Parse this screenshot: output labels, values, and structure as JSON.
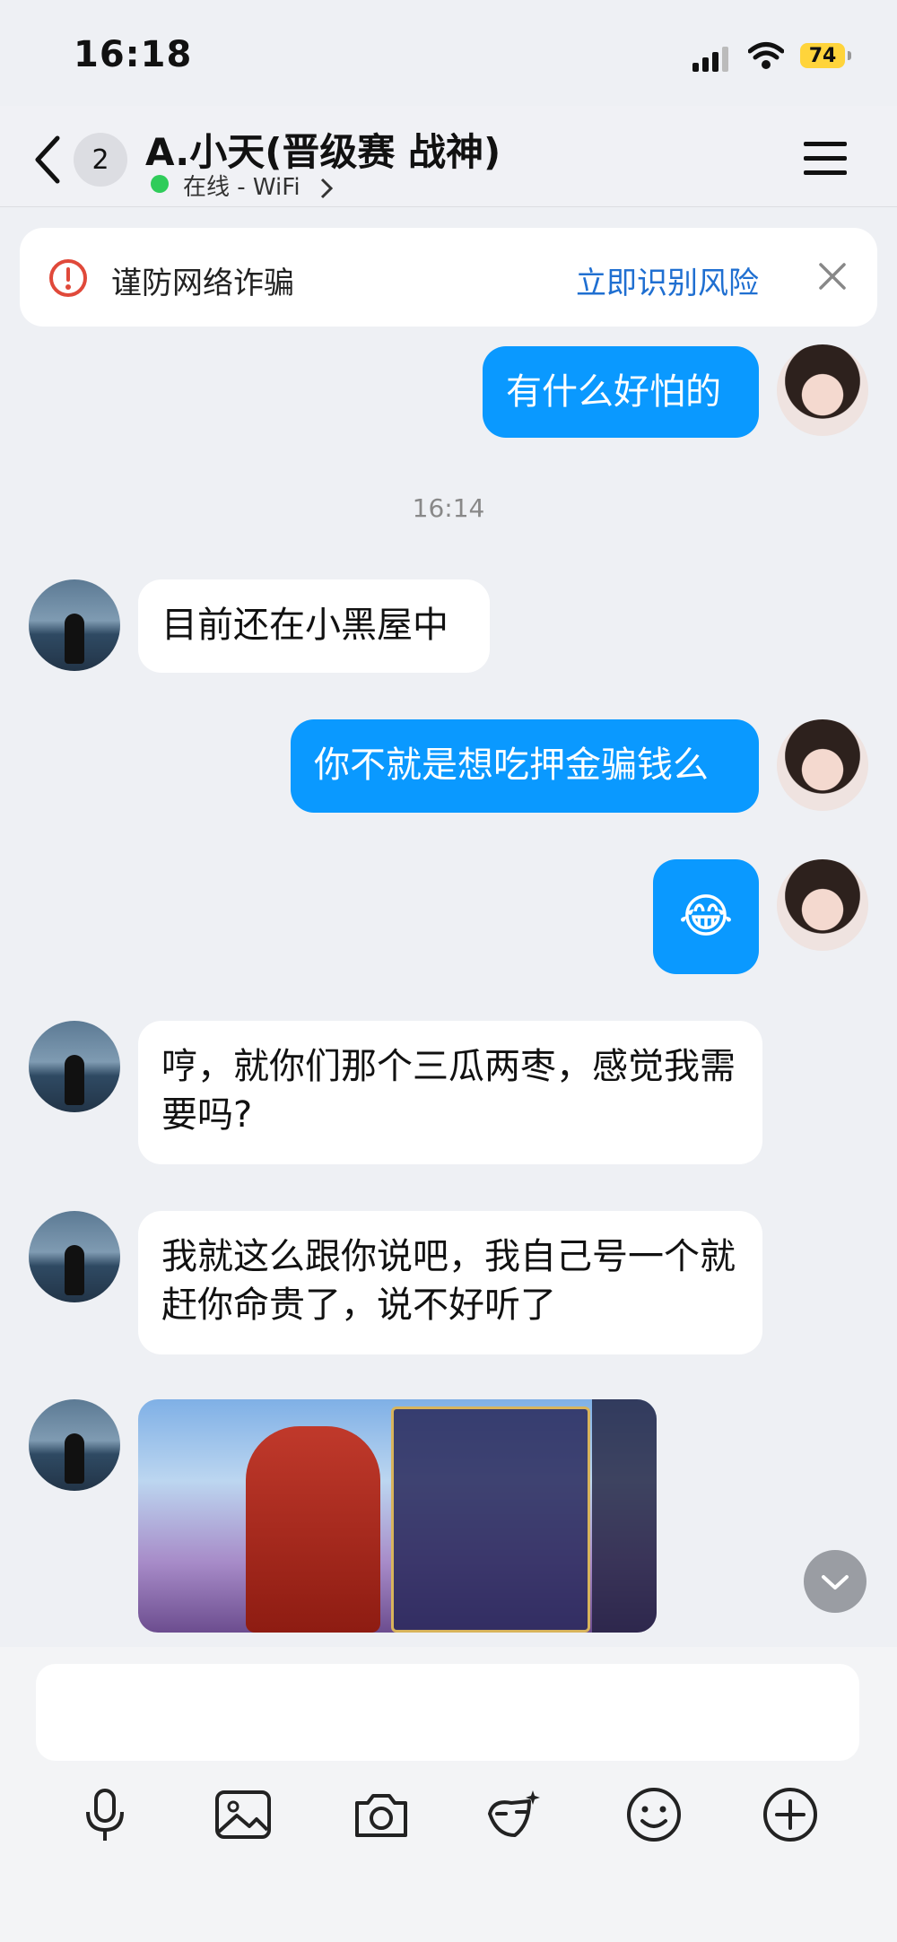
{
  "status_bar": {
    "time": "16:18",
    "battery": "74"
  },
  "header": {
    "unread_count": "2",
    "title": "A.小天(晋级赛 战神)",
    "status": "在线 - WiFi"
  },
  "warning": {
    "text": "谨防网络诈骗",
    "action": "立即识别风险"
  },
  "messages": [
    {
      "side": "out",
      "text": "有什么好怕的"
    },
    {
      "timestamp": "16:14"
    },
    {
      "side": "in",
      "text": "目前还在小黑屋中"
    },
    {
      "side": "out",
      "text": "你不就是想吃押金骗钱么"
    },
    {
      "side": "out",
      "text": "😂"
    },
    {
      "side": "in",
      "text": "哼，就你们那个三瓜两枣，感觉我需要吗?"
    },
    {
      "side": "in",
      "text": "我就这么跟你说吧，我自己号一个就赶你命贵了，说不好听了"
    },
    {
      "side": "in",
      "type": "image"
    }
  ],
  "toolbar": {
    "icons": [
      "microphone-icon",
      "image-icon",
      "camera-icon",
      "sticker-icon",
      "emoji-icon",
      "plus-icon"
    ]
  },
  "colors": {
    "outgoing_bubble": "#0a99ff",
    "incoming_bubble": "#ffffff",
    "link": "#1f6fd1",
    "warning": "#e0493a"
  }
}
